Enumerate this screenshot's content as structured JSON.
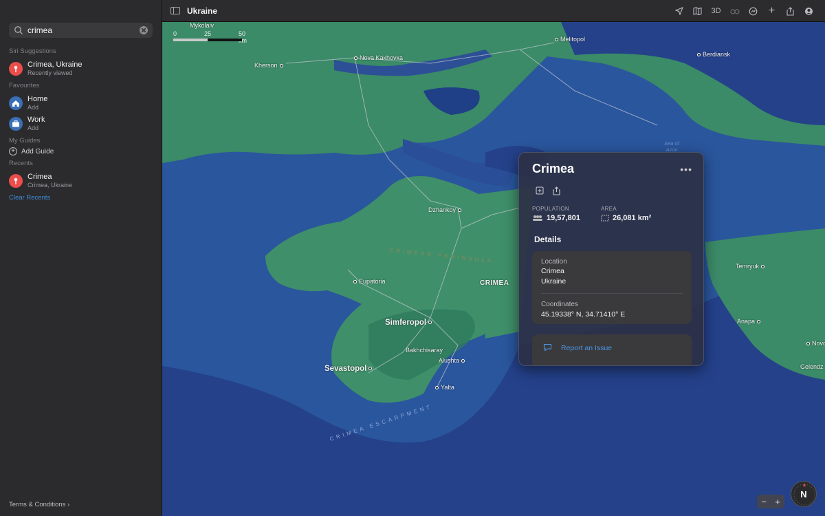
{
  "sidebar": {
    "search_value": "crimea",
    "siri_header": "Siri Suggestions",
    "siri_item": {
      "title": "Crimea, Ukraine",
      "subtitle": "Recently viewed"
    },
    "favourites_header": "Favourites",
    "favourites": [
      {
        "title": "Home",
        "subtitle": "Add",
        "icon": "house-icon"
      },
      {
        "title": "Work",
        "subtitle": "Add",
        "icon": "briefcase-icon"
      }
    ],
    "guides_header": "My Guides",
    "add_guide": "Add Guide",
    "recents_header": "Recents",
    "recent_item": {
      "title": "Crimea",
      "subtitle": "Crimea, Ukraine"
    },
    "clear_recents": "Clear Recents",
    "terms": "Terms & Conditions"
  },
  "toolbar": {
    "title": "Ukraine",
    "three_d": "3D"
  },
  "map": {
    "scale": {
      "zero": "0",
      "mid": "25",
      "end": "50 km"
    },
    "labels": {
      "mykolaiv": "Mykolaiv",
      "melitopol": "Melitopol",
      "kherson": "Kherson",
      "nova_kakhovka": "Nova Kakhovka",
      "berdiansk": "Berdiansk",
      "sea_of_azov_1": "Sea of",
      "sea_of_azov_2": "Azov",
      "dzhankoy": "Dzhankoy",
      "crimean_peninsula": "CRIMEAN PENINSULA",
      "crimea": "CRIMEA",
      "eupatoria": "Eupatoria",
      "simferopol": "Simferopol",
      "bakhchisaray": "Bakhchisaray",
      "alushta": "Alushta",
      "sevastopol": "Sevastopol",
      "yalta": "Yalta",
      "escarpment": "CRIMEA ESCARPMENT",
      "temryuk": "Temryuk",
      "anapa": "Anapa",
      "novo": "Novo",
      "gelendz": "Gelendz"
    }
  },
  "card": {
    "title": "Crimea",
    "population_label": "POPULATION",
    "population_value": "19,57,801",
    "area_label": "AREA",
    "area_value": "26,081 km²",
    "details_header": "Details",
    "location_label": "Location",
    "location_line1": "Crimea",
    "location_line2": "Ukraine",
    "coordinates_label": "Coordinates",
    "coordinates_value": "45.19338° N, 34.71410° E",
    "report": "Report an Issue"
  },
  "compass": {
    "label": "N"
  },
  "colors": {
    "sea": "#24418a",
    "land": "#3b8a68",
    "accent": "#3d8bdb",
    "pin": "#eb4d4b"
  }
}
